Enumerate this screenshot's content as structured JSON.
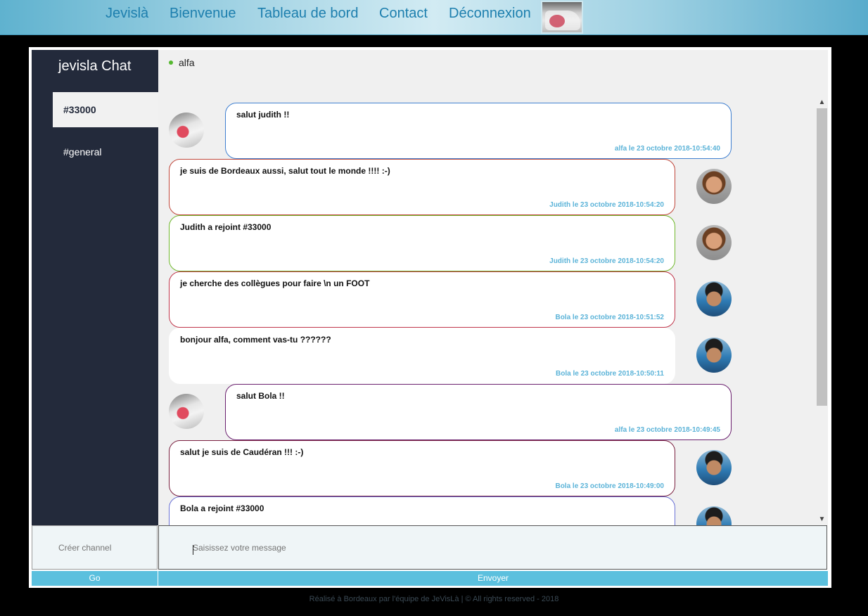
{
  "nav": {
    "links": [
      "Jevislà",
      "Bienvenue",
      "Tableau de bord",
      "Contact",
      "Déconnexion"
    ]
  },
  "sidebar": {
    "title": "jevisla Chat",
    "channels": [
      {
        "label": "#33000",
        "active": true
      },
      {
        "label": "#general",
        "active": false
      }
    ]
  },
  "header": {
    "online_user": "alfa"
  },
  "messages": [
    {
      "text": "salut judith !!",
      "meta": "alfa le 23 octobre 2018-10:54:40",
      "side": "self",
      "border": "#3f7fd0"
    },
    {
      "text": "je suis de Bordeaux aussi, salut tout le monde !!!! :-)",
      "meta": "Judith le 23 octobre 2018-10:54:20",
      "side": "other",
      "border": "#c0463a"
    },
    {
      "text": "Judith a rejoint #33000",
      "meta": "Judith le 23 octobre 2018-10:54:20",
      "side": "other",
      "border": "#6fb82b"
    },
    {
      "text": "je cherche des collègues pour faire \\n un FOOT",
      "meta": "Bola le 23 octobre 2018-10:51:52",
      "side": "other",
      "border": "#c0354a"
    },
    {
      "text": "bonjour alfa, comment vas-tu ??????",
      "meta": "Bola le 23 octobre 2018-10:50:11",
      "side": "other",
      "border": "#ffffff"
    },
    {
      "text": "salut Bola !!",
      "meta": "alfa le 23 octobre 2018-10:49:45",
      "side": "self",
      "border": "#6a1f6e"
    },
    {
      "text": "salut je suis de Caudéran !!! :-)",
      "meta": "Bola le 23 octobre 2018-10:49:00",
      "side": "other",
      "border": "#7a1f3f"
    },
    {
      "text": "Bola a rejoint #33000",
      "meta": "",
      "side": "other",
      "border": "#6b73d6"
    }
  ],
  "controls": {
    "create_channel_placeholder": "Créer channel",
    "message_placeholder": "Saisissez votre message",
    "go_label": "Go",
    "send_label": "Envoyer"
  },
  "footer": {
    "text": "Réalisé à Bordeaux par l'équipe de JeVisLà | © All rights reserved - 2018"
  },
  "colors": {
    "sidebar_bg": "#232a3b",
    "button_bg": "#5bc0de",
    "meta_text": "#5bb3d8",
    "online_dot": "#55b82f"
  }
}
